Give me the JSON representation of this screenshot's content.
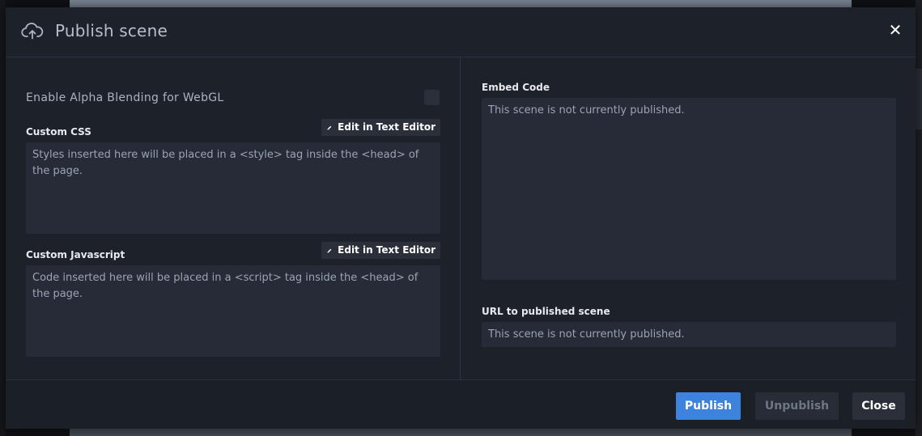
{
  "dialog": {
    "title": "Publish scene",
    "header_icon": "cloud-upload-icon",
    "close_icon": "close-icon",
    "close_glyph": "✕"
  },
  "settings": {
    "alpha_blending_label": "Enable Alpha Blending for WebGL",
    "alpha_blending_checked": false,
    "custom_css": {
      "label": "Custom CSS",
      "edit_button_label": "Edit in Text Editor",
      "placeholder": "Styles inserted here will be placed in a <style> tag inside the <head> of the page.",
      "value": ""
    },
    "custom_js": {
      "label": "Custom Javascript",
      "edit_button_label": "Edit in Text Editor",
      "placeholder": "Code inserted here will be placed in a <script> tag inside the <head> of the page.",
      "value": ""
    }
  },
  "publish_info": {
    "embed_code_label": "Embed Code",
    "embed_code_value": "This scene is not currently published.",
    "url_label": "URL to published scene",
    "url_value": "This scene is not currently published."
  },
  "footer": {
    "publish_label": "Publish",
    "unpublish_label": "Unpublish",
    "close_label": "Close"
  },
  "colors": {
    "accent": "#3d82dc",
    "modal_bg": "#1d2129",
    "field_bg": "#262b37"
  }
}
